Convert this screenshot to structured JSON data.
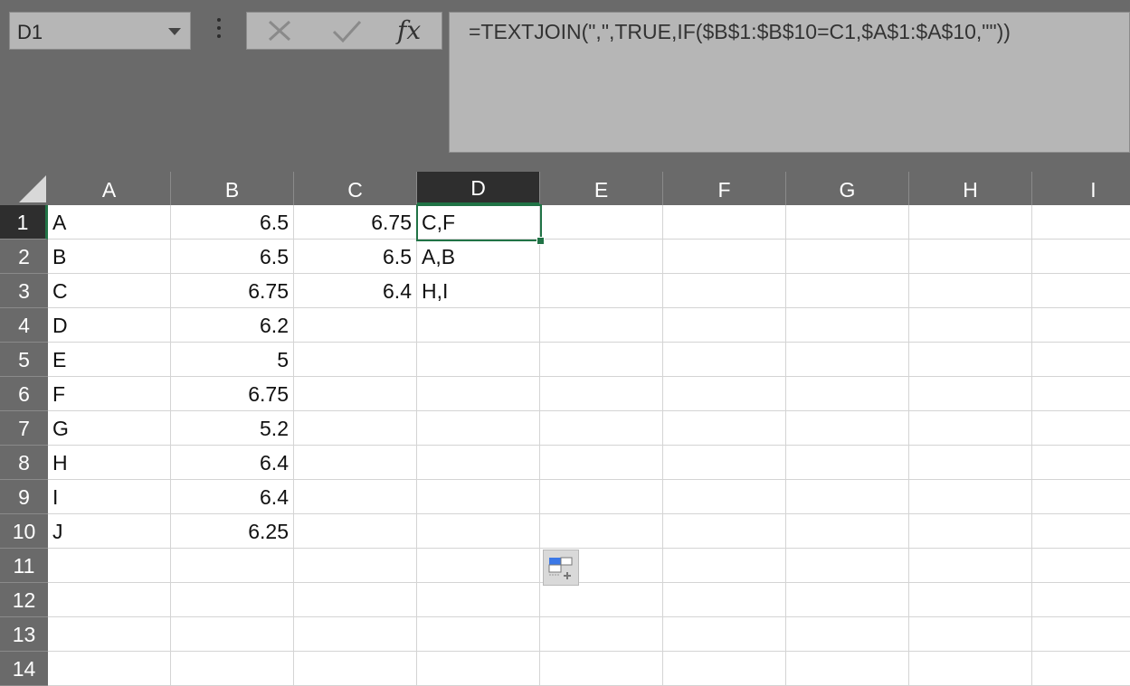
{
  "name_box": {
    "value": "D1"
  },
  "formula_bar": {
    "fx_label": "fx",
    "formula": "=TEXTJOIN(\",\",TRUE,IF($B$1:$B$10=C1,$A$1:$A$10,\"\"))"
  },
  "columns": [
    "A",
    "B",
    "C",
    "D",
    "E",
    "F",
    "G",
    "H",
    "I"
  ],
  "rows": [
    "1",
    "2",
    "3",
    "4",
    "5",
    "6",
    "7",
    "8",
    "9",
    "10",
    "11",
    "12",
    "13",
    "14"
  ],
  "cells": {
    "A": [
      "A",
      "B",
      "C",
      "D",
      "E",
      "F",
      "G",
      "H",
      "I",
      "J"
    ],
    "B": [
      "6.5",
      "6.5",
      "6.75",
      "6.2",
      "5",
      "6.75",
      "5.2",
      "6.4",
      "6.4",
      "6.25"
    ],
    "C": [
      "6.75",
      "6.5",
      "6.4"
    ],
    "D": [
      "C,F",
      "A,B",
      "H,I"
    ]
  },
  "selection": {
    "active_column": "D",
    "active_row": "1"
  },
  "colors": {
    "accent": "#217346",
    "header_bg": "#6a6a6a",
    "formula_bg": "#b6b6b6"
  }
}
